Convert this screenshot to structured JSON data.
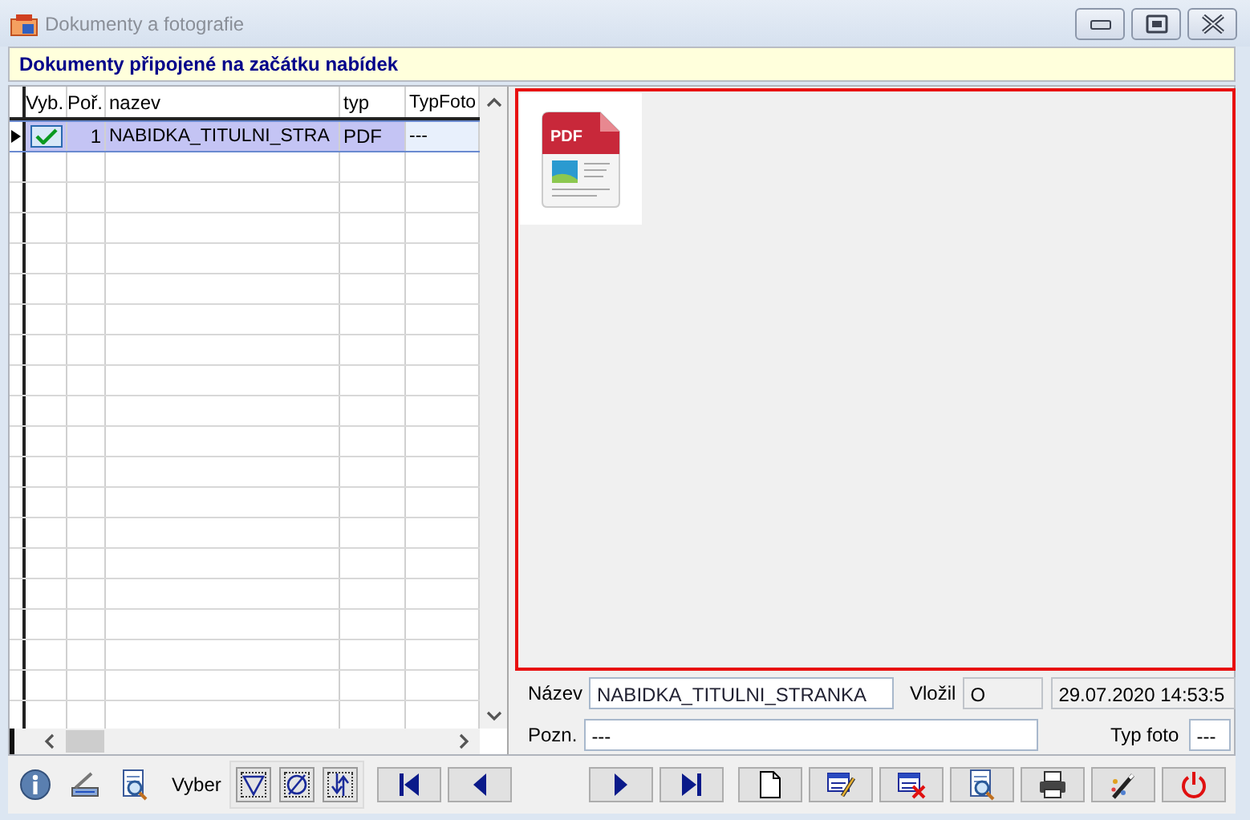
{
  "window": {
    "title": "Dokumenty a fotografie"
  },
  "banner": "Dokumenty  připojené na začátku nabídek",
  "grid": {
    "columns": [
      "Vyb.",
      "Poř.",
      "nazev",
      "typ",
      "TypFoto"
    ],
    "rows": [
      {
        "selected": true,
        "checked": true,
        "order": "1",
        "name": "NABIDKA_TITULNI_STRA",
        "type": "PDF",
        "typ_foto": "---"
      }
    ]
  },
  "preview": {
    "items": [
      {
        "kind": "pdf",
        "label": "PDF",
        "selected": true
      }
    ]
  },
  "details": {
    "nazev_label": "Název",
    "nazev": "NABIDKA_TITULNI_STRANKA",
    "vlozil_label": "Vložil",
    "vlozil": "O",
    "date": "29.07.2020 14:53:5",
    "pozn_label": "Pozn.",
    "pozn": "---",
    "typ_foto_label": "Typ foto",
    "typ_foto": "---"
  },
  "toolbar": {
    "filter_label": "Vyber"
  }
}
